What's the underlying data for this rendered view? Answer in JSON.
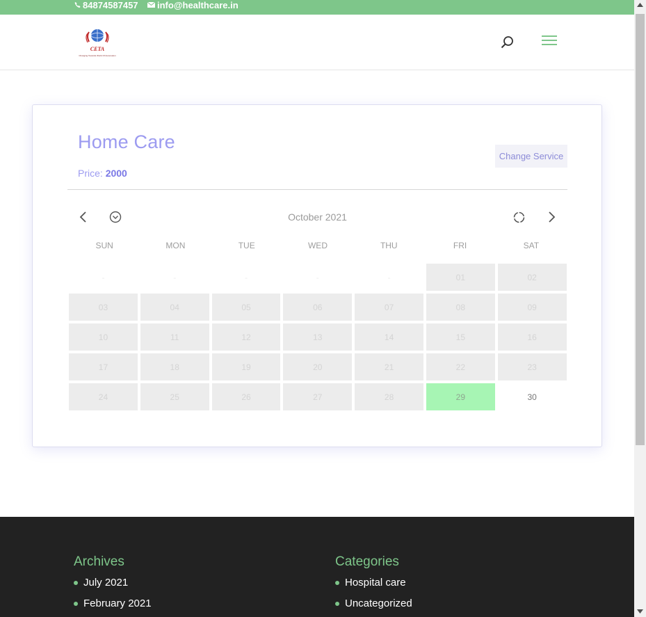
{
  "topbar": {
    "phone": "84874587457",
    "email": "info@healthcare.in",
    "phone_icon": "phone-icon",
    "email_icon": "envelope-icon",
    "bg_color": "#7ec68a"
  },
  "header": {
    "logo_text": "CETA",
    "logo_tagline": "Changing Towards World Of Automation",
    "search_icon": "search-icon",
    "menu_icon": "hamburger-menu-icon"
  },
  "service": {
    "title": "Home Care",
    "price_label": "Price:",
    "price_value": "2000",
    "change_button": "Change Service"
  },
  "calendar": {
    "month_label": "October 2021",
    "prev_icon": "chevron-left-icon",
    "dropdown_icon": "chevron-down-circle-icon",
    "reset_icon": "reset-circle-icon",
    "next_icon": "chevron-right-icon",
    "weekdays": [
      "SUN",
      "MON",
      "TUE",
      "WED",
      "THU",
      "FRI",
      "SAT"
    ],
    "cells": [
      {
        "label": "-",
        "state": "empty"
      },
      {
        "label": "-",
        "state": "empty"
      },
      {
        "label": "-",
        "state": "empty"
      },
      {
        "label": "-",
        "state": "empty"
      },
      {
        "label": "-",
        "state": "empty"
      },
      {
        "label": "01",
        "state": "disabled"
      },
      {
        "label": "02",
        "state": "disabled"
      },
      {
        "label": "03",
        "state": "disabled"
      },
      {
        "label": "04",
        "state": "disabled"
      },
      {
        "label": "05",
        "state": "disabled"
      },
      {
        "label": "06",
        "state": "disabled"
      },
      {
        "label": "07",
        "state": "disabled"
      },
      {
        "label": "08",
        "state": "disabled"
      },
      {
        "label": "09",
        "state": "disabled"
      },
      {
        "label": "10",
        "state": "disabled"
      },
      {
        "label": "11",
        "state": "disabled"
      },
      {
        "label": "12",
        "state": "disabled"
      },
      {
        "label": "13",
        "state": "disabled"
      },
      {
        "label": "14",
        "state": "disabled"
      },
      {
        "label": "15",
        "state": "disabled"
      },
      {
        "label": "16",
        "state": "disabled"
      },
      {
        "label": "17",
        "state": "disabled"
      },
      {
        "label": "18",
        "state": "disabled"
      },
      {
        "label": "19",
        "state": "disabled"
      },
      {
        "label": "20",
        "state": "disabled"
      },
      {
        "label": "21",
        "state": "disabled"
      },
      {
        "label": "22",
        "state": "disabled"
      },
      {
        "label": "23",
        "state": "disabled"
      },
      {
        "label": "24",
        "state": "disabled"
      },
      {
        "label": "25",
        "state": "disabled"
      },
      {
        "label": "26",
        "state": "disabled"
      },
      {
        "label": "27",
        "state": "disabled"
      },
      {
        "label": "28",
        "state": "disabled"
      },
      {
        "label": "29",
        "state": "selected"
      },
      {
        "label": "30",
        "state": "available"
      }
    ],
    "selected_color": "#a7f5b4"
  },
  "footer": {
    "archives_title": "Archives",
    "archives": [
      "July 2021",
      "February 2021"
    ],
    "categories_title": "Categories",
    "categories": [
      "Hospital care",
      "Uncategorized"
    ]
  }
}
